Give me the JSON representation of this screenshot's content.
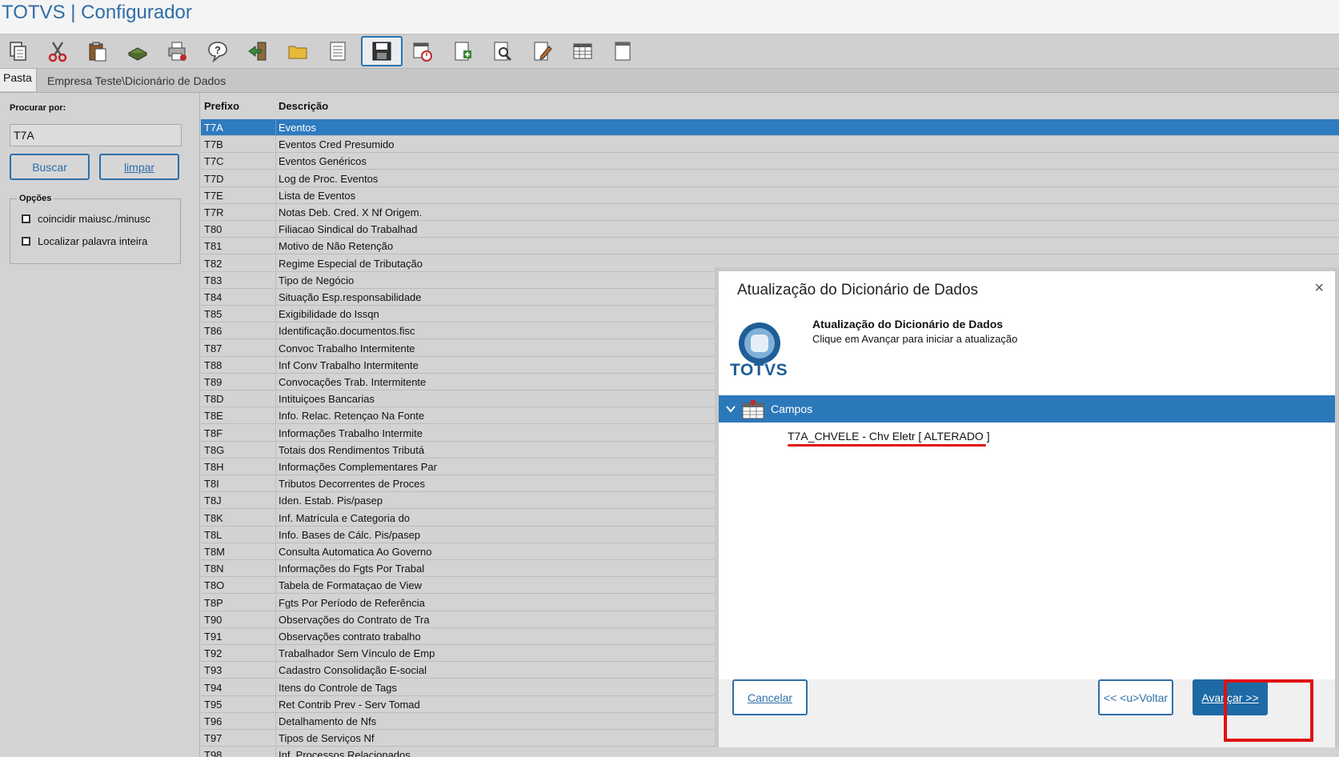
{
  "app": {
    "title": "TOTVS | Configurador"
  },
  "toolbar": {
    "buttons": [
      {
        "icon": "copy-icon"
      },
      {
        "icon": "cut-icon"
      },
      {
        "icon": "paste-icon"
      },
      {
        "icon": "database-icon"
      },
      {
        "icon": "print-icon"
      },
      {
        "icon": "help-icon"
      },
      {
        "icon": "exit-icon"
      },
      {
        "icon": "folder-icon"
      },
      {
        "icon": "list-icon"
      },
      {
        "icon": "save-icon"
      },
      {
        "icon": "calendar-clock-icon"
      },
      {
        "icon": "add-document-icon"
      },
      {
        "icon": "search-document-icon"
      },
      {
        "icon": "edit-icon"
      },
      {
        "icon": "table-icon"
      },
      {
        "icon": "document-icon"
      }
    ]
  },
  "tabs": {
    "pasta": "Pasta",
    "path": "Empresa Teste\\Dicionário de Dados"
  },
  "search": {
    "label": "Procurar por:",
    "value": "T7A",
    "buscar": "Buscar",
    "limpar": "limpar",
    "options_title": "Opções",
    "option1": "coincidir maiusc./minusc",
    "option2": "Localizar palavra inteira"
  },
  "grid": {
    "headers": {
      "prefix": "Prefixo",
      "description": "Descrição"
    },
    "rows": [
      {
        "p": "T7A",
        "d": "Eventos",
        "selected": true
      },
      {
        "p": "T7B",
        "d": "Eventos Cred Presumido"
      },
      {
        "p": "T7C",
        "d": "Eventos Genéricos"
      },
      {
        "p": "T7D",
        "d": "Log de Proc. Eventos"
      },
      {
        "p": "T7E",
        "d": "Lista de Eventos"
      },
      {
        "p": "T7R",
        "d": "Notas Deb. Cred. X Nf Origem."
      },
      {
        "p": "T80",
        "d": "Filiacao Sindical do Trabalhad"
      },
      {
        "p": "T81",
        "d": "Motivo de Não Retenção"
      },
      {
        "p": "T82",
        "d": "Regime Especial de Tributação"
      },
      {
        "p": "T83",
        "d": "Tipo de Negócio"
      },
      {
        "p": "T84",
        "d": "Situação Esp.responsabilidade"
      },
      {
        "p": "T85",
        "d": "Exigibilidade do Issqn"
      },
      {
        "p": "T86",
        "d": "Identificação.documentos.fisc"
      },
      {
        "p": "T87",
        "d": "Convoc Trabalho Intermitente"
      },
      {
        "p": "T88",
        "d": "Inf Conv Trabalho Intermitente"
      },
      {
        "p": "T89",
        "d": "Convocações Trab. Intermitente"
      },
      {
        "p": "T8D",
        "d": "Intituiçoes Bancarias"
      },
      {
        "p": "T8E",
        "d": "Info. Relac. Retençao Na Fonte"
      },
      {
        "p": "T8F",
        "d": "Informações Trabalho Intermite"
      },
      {
        "p": "T8G",
        "d": "Totais dos Rendimentos Tributá"
      },
      {
        "p": "T8H",
        "d": "Informações Complementares Par"
      },
      {
        "p": "T8I",
        "d": "Tributos Decorrentes de Proces"
      },
      {
        "p": "T8J",
        "d": "Iden. Estab. Pis/pasep"
      },
      {
        "p": "T8K",
        "d": "Inf. Matrícula e Categoria do"
      },
      {
        "p": "T8L",
        "d": "Info. Bases de Cálc. Pis/pasep"
      },
      {
        "p": "T8M",
        "d": "Consulta Automatica Ao Governo"
      },
      {
        "p": "T8N",
        "d": "Informações do Fgts Por Trabal"
      },
      {
        "p": "T8O",
        "d": "Tabela de Formataçao de View"
      },
      {
        "p": "T8P",
        "d": "Fgts Por Período de Referência"
      },
      {
        "p": "T90",
        "d": "Observações do Contrato de Tra"
      },
      {
        "p": "T91",
        "d": "Observações contrato trabalho"
      },
      {
        "p": "T92",
        "d": "Trabalhador Sem Vínculo de Emp"
      },
      {
        "p": "T93",
        "d": "Cadastro Consolidação E-social"
      },
      {
        "p": "T94",
        "d": "Itens do Controle de Tags"
      },
      {
        "p": "T95",
        "d": "Ret Contrib Prev - Serv Tomad"
      },
      {
        "p": "T96",
        "d": "Detalhamento de Nfs"
      },
      {
        "p": "T97",
        "d": "Tipos de Serviços Nf"
      },
      {
        "p": "T98",
        "d": "Inf. Processos Relacionados"
      }
    ]
  },
  "dialog": {
    "title": "Atualização do Dicionário de Dados",
    "close": "×",
    "logo_text": "TOTVS",
    "heading": "Atualização do Dicionário de Dados",
    "subtitle": "Clique em Avançar para iniciar a atualização",
    "tree_root": "Campos",
    "tree_item": "T7A_CHVELE - Chv Eletr [ ALTERADO ]",
    "btn_cancel": "Cancelar",
    "btn_back": "<< <u>Voltar",
    "btn_next": "Avançar >>"
  },
  "colors": {
    "accent": "#2f7bbf",
    "highlight": "#e01010",
    "title": "#2f6da8"
  }
}
